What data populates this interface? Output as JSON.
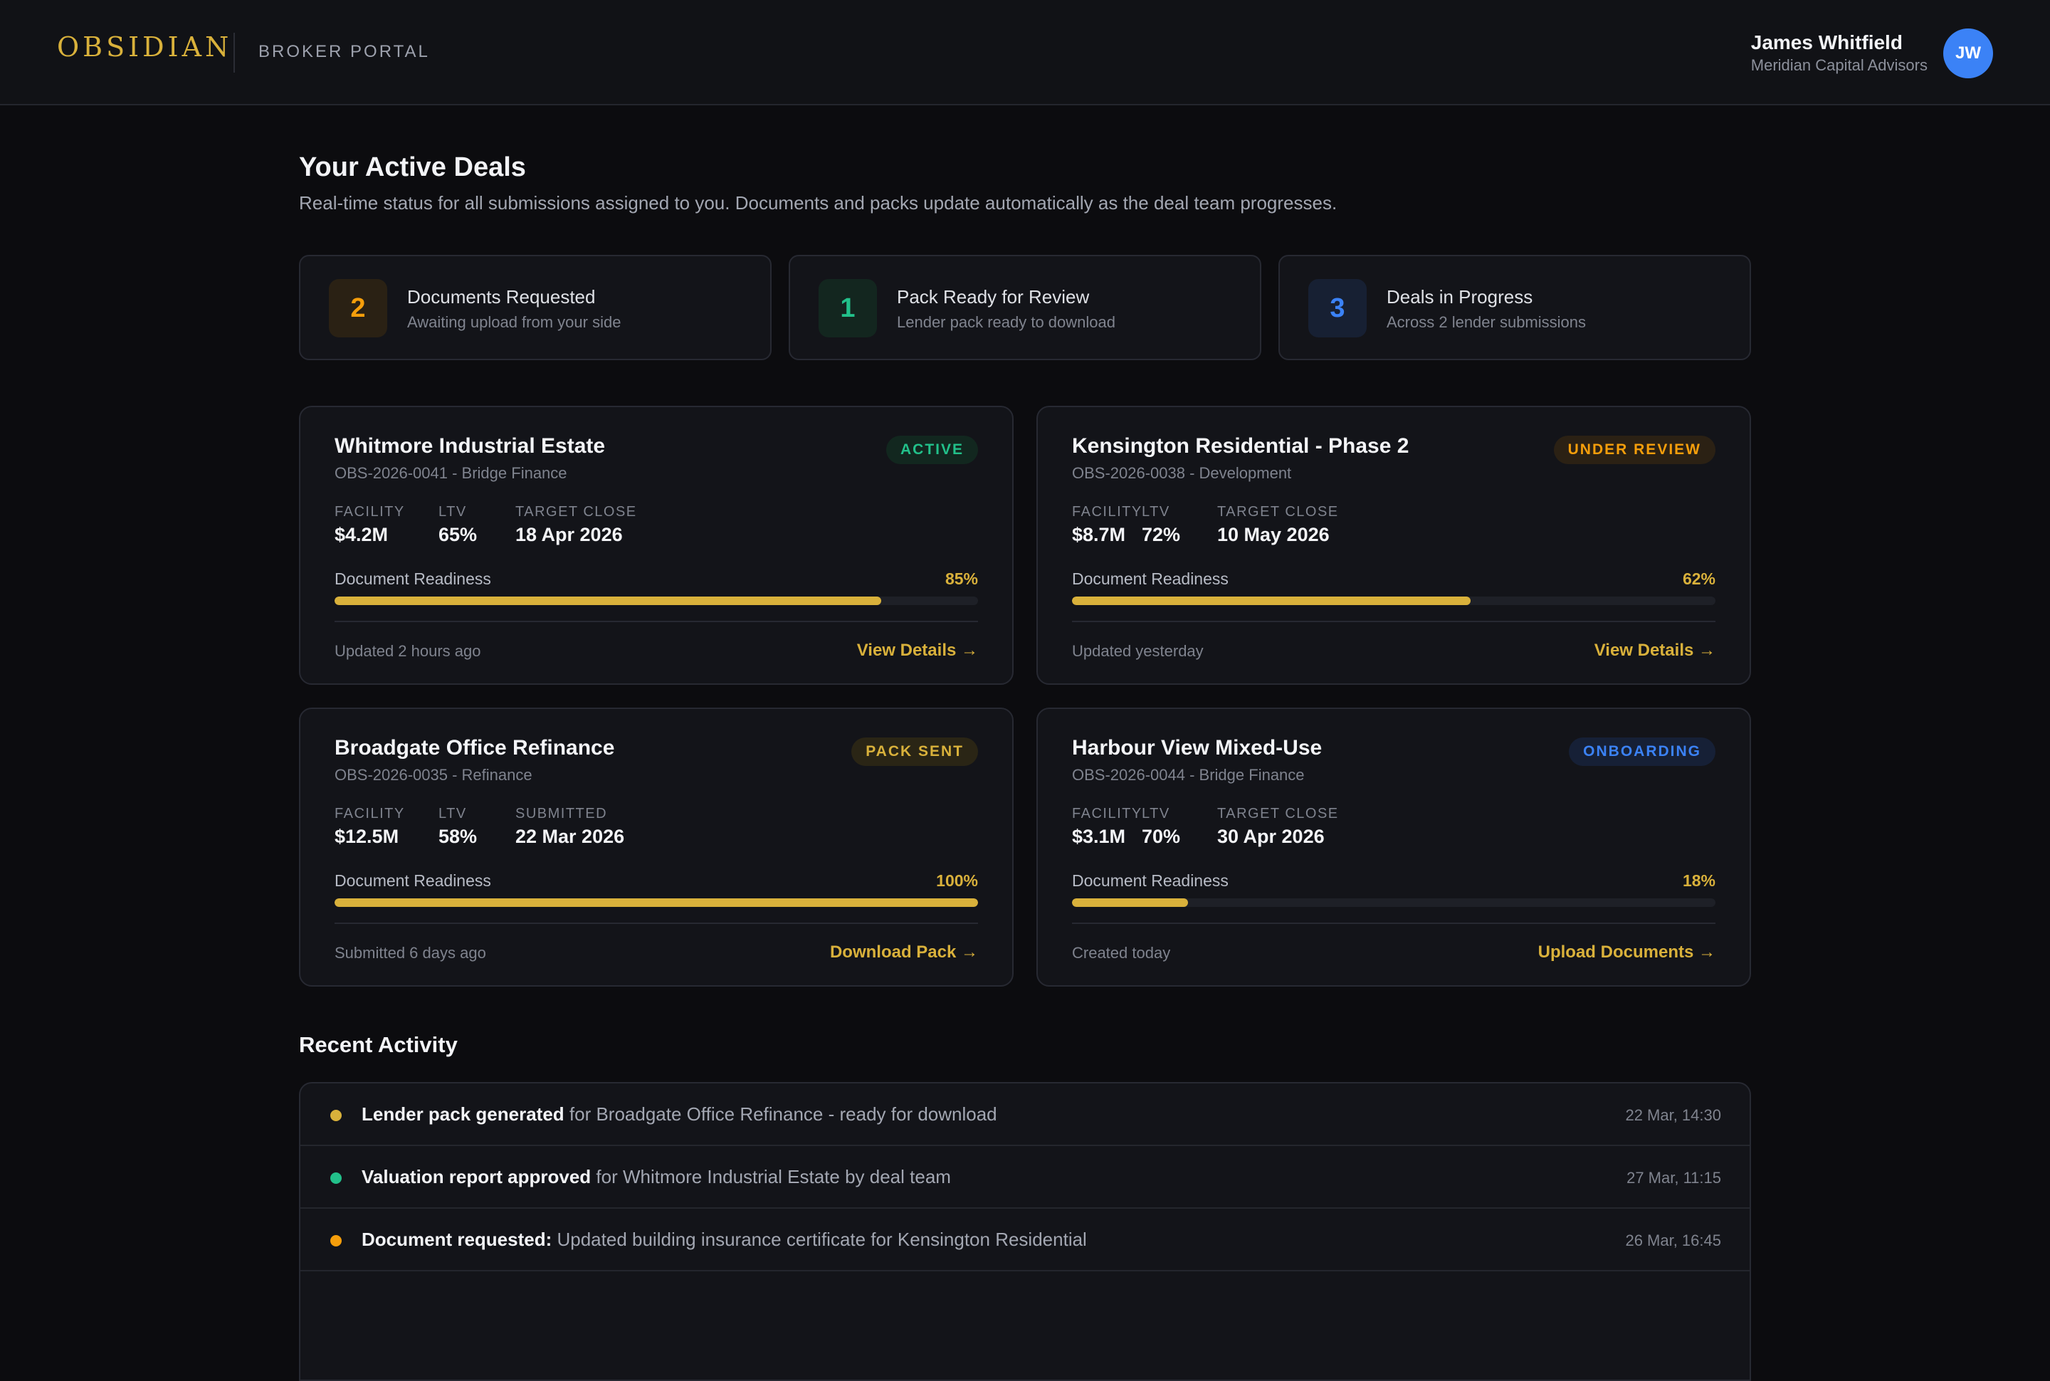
{
  "header": {
    "brand": "OBSIDIAN",
    "portal_label": "BROKER PORTAL",
    "user_name": "James Whitfield",
    "user_org": "Meridian Capital Advisors",
    "avatar_initials": "JW",
    "avatar_color": "#3b82f6"
  },
  "page": {
    "title": "Your Active Deals",
    "subtitle": "Real-time status for all submissions assigned to you. Documents and packs update automatically as the deal team progresses."
  },
  "stats": [
    {
      "count": "2",
      "title": "Documents Requested",
      "desc": "Awaiting upload from your side",
      "color": "#f59e0b",
      "bg": "#2a2114"
    },
    {
      "count": "1",
      "title": "Pack Ready for Review",
      "desc": "Lender pack ready to download",
      "color": "#22c08a",
      "bg": "#13261f"
    },
    {
      "count": "3",
      "title": "Deals in Progress",
      "desc": "Across 2 lender submissions",
      "color": "#3b82f6",
      "bg": "#172033"
    }
  ],
  "deals": [
    {
      "name": "Whitmore Industrial Estate",
      "ref": "OBS-2026-0041 - Bridge Finance",
      "status": "ACTIVE",
      "status_color": "#22c08a",
      "status_bg": "#12271f",
      "metrics": [
        {
          "label": "FACILITY",
          "value": "$4.2M"
        },
        {
          "label": "LTV",
          "value": "65%"
        },
        {
          "label": "TARGET CLOSE",
          "value": "18 Apr 2026"
        }
      ],
      "readiness_label": "Document Readiness",
      "readiness": 85,
      "readiness_text": "85%",
      "updated": "Updated 2 hours ago",
      "action": "View Details →"
    },
    {
      "name": "Kensington Residential - Phase 2",
      "ref": "OBS-2026-0038 - Development",
      "status": "UNDER REVIEW",
      "status_color": "#f59e0b",
      "status_bg": "#2b2114",
      "metrics": [
        {
          "label": "FACILITY",
          "value": "$8.7M"
        },
        {
          "label": "LTV",
          "value": "72%"
        },
        {
          "label": "TARGET CLOSE",
          "value": "10 May 2026"
        }
      ],
      "readiness_label": "Document Readiness",
      "readiness": 62,
      "readiness_text": "62%",
      "updated": "Updated yesterday",
      "action": "View Details →"
    },
    {
      "name": "Broadgate Office Refinance",
      "ref": "OBS-2026-0035 - Refinance",
      "status": "PACK SENT",
      "status_color": "#d9b13b",
      "status_bg": "#2a2515",
      "metrics": [
        {
          "label": "FACILITY",
          "value": "$12.5M"
        },
        {
          "label": "LTV",
          "value": "58%"
        },
        {
          "label": "SUBMITTED",
          "value": "22 Mar 2026"
        }
      ],
      "readiness_label": "Document Readiness",
      "readiness": 100,
      "readiness_text": "100%",
      "updated": "Submitted 6 days ago",
      "action": "Download Pack →"
    },
    {
      "name": "Harbour View Mixed-Use",
      "ref": "OBS-2026-0044 - Bridge Finance",
      "status": "ONBOARDING",
      "status_color": "#3b82f6",
      "status_bg": "#162036",
      "metrics": [
        {
          "label": "FACILITY",
          "value": "$3.1M"
        },
        {
          "label": "LTV",
          "value": "70%"
        },
        {
          "label": "TARGET CLOSE",
          "value": "30 Apr 2026"
        }
      ],
      "readiness_label": "Document Readiness",
      "readiness": 18,
      "readiness_text": "18%",
      "updated": "Created today",
      "action": "Upload Documents →"
    }
  ],
  "activity": {
    "title": "Recent Activity",
    "items": [
      {
        "strong": "Lender pack generated",
        "rest": " for Broadgate Office Refinance - ready for download",
        "time": "22 Mar, 14:30",
        "dot_color": "#d9b13b"
      },
      {
        "strong": "Valuation report approved",
        "rest": " for Whitmore Industrial Estate by deal team",
        "time": "27 Mar, 11:15",
        "dot_color": "#22c08a"
      },
      {
        "strong": "Document requested:",
        "rest": " Updated building insurance certificate for Kensington Residential",
        "time": "26 Mar, 16:45",
        "dot_color": "#f59e0b"
      }
    ]
  }
}
